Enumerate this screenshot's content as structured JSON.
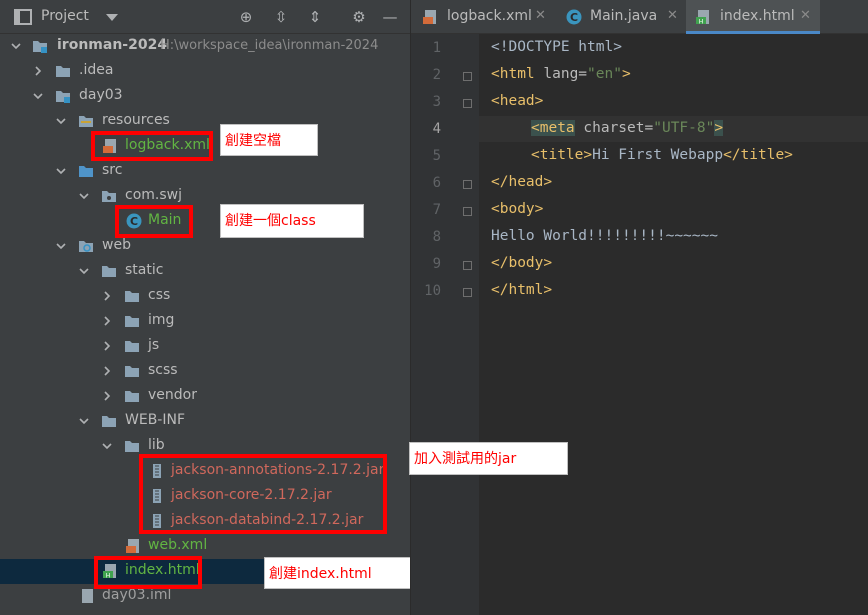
{
  "project_panel": {
    "title": "Project",
    "tree": [
      {
        "label": "ironman-2024",
        "path": "H:\\workspace_idea\\ironman-2024"
      },
      {
        "label": ".idea"
      },
      {
        "label": "day03"
      },
      {
        "label": "resources"
      },
      {
        "label": "logback.xml"
      },
      {
        "label": "src"
      },
      {
        "label": "com.swj"
      },
      {
        "label": "Main"
      },
      {
        "label": "web"
      },
      {
        "label": "static"
      },
      {
        "label": "css"
      },
      {
        "label": "img"
      },
      {
        "label": "js"
      },
      {
        "label": "scss"
      },
      {
        "label": "vendor"
      },
      {
        "label": "WEB-INF"
      },
      {
        "label": "lib"
      },
      {
        "label": "jackson-annotations-2.17.2.jar"
      },
      {
        "label": "jackson-core-2.17.2.jar"
      },
      {
        "label": "jackson-databind-2.17.2.jar"
      },
      {
        "label": "web.xml"
      },
      {
        "label": "index.html"
      },
      {
        "label": "day03.iml"
      }
    ]
  },
  "annotations": {
    "logback": "創建空檔",
    "main": "創建一個class",
    "jars": "加入測試用的jar",
    "index": "創建index.html"
  },
  "editor": {
    "tabs": [
      {
        "label": "logback.xml"
      },
      {
        "label": "Main.java"
      },
      {
        "label": "index.html",
        "active": true
      }
    ],
    "line_numbers": [
      "1",
      "2",
      "3",
      "4",
      "5",
      "6",
      "7",
      "8",
      "9",
      "10"
    ],
    "current_line": 4,
    "code": {
      "l1": "<!DOCTYPE html>",
      "l2_open": "<html",
      "l2_attr": " lang=",
      "l2_val": "\"en\"",
      "l2_close": ">",
      "l3": "<head>",
      "l4_open": "<meta",
      "l4_attr": " charset=",
      "l4_val": "\"UTF-8\"",
      "l4_close": ">",
      "l5_open": "<title>",
      "l5_text": "Hi First Webapp",
      "l5_close": "</title>",
      "l6": "</head>",
      "l7": "<body>",
      "l8": "Hello World!!!!!!!!!~~~~~~",
      "l9": "</body>",
      "l10": "</html>"
    }
  },
  "colors": {
    "accent": "#4a88c7",
    "highlight": "#ff0000",
    "selection": "#0d293e"
  }
}
